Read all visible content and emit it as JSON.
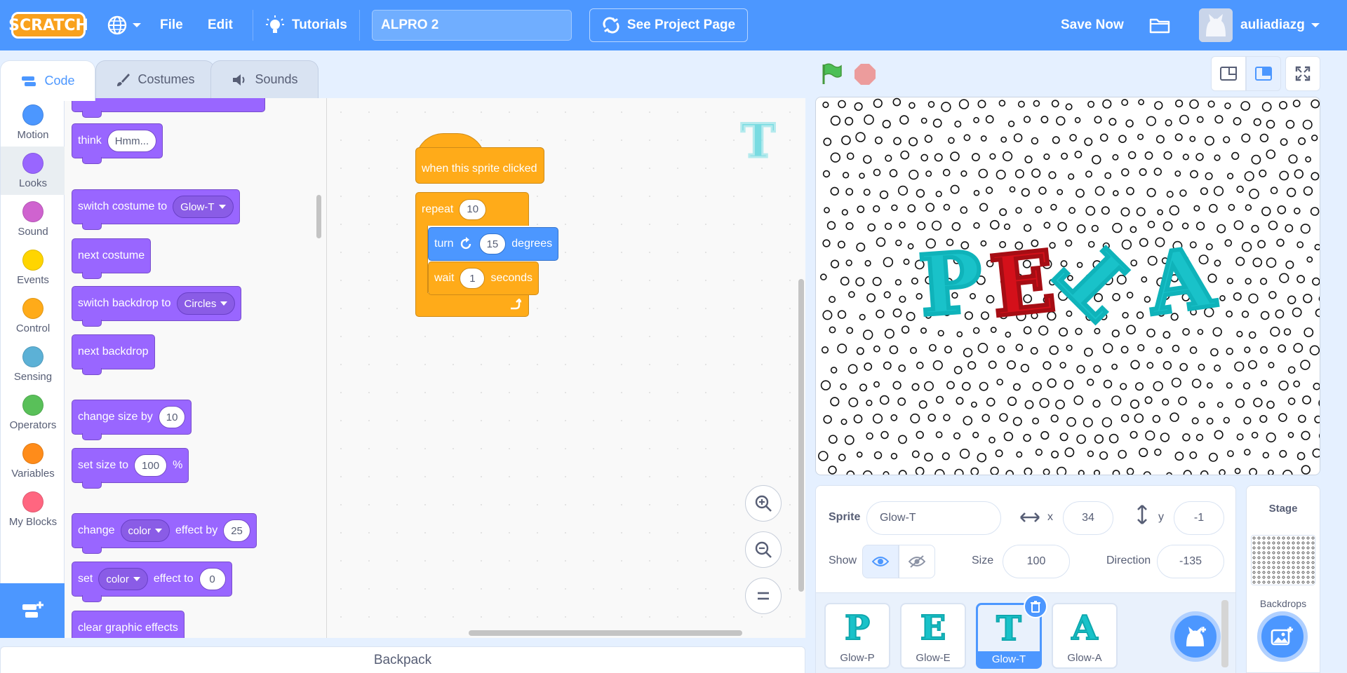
{
  "menubar": {
    "logo": "SCRATCH",
    "language_icon": "globe-icon",
    "file": "File",
    "edit": "Edit",
    "tutorials": "Tutorials",
    "project_title": "ALPRO 2",
    "see_project": "See Project Page",
    "save_now": "Save Now",
    "username": "auliadiazg"
  },
  "tabs": {
    "code": "Code",
    "costumes": "Costumes",
    "sounds": "Sounds"
  },
  "categories": [
    {
      "label": "Motion",
      "color": "#4c97ff"
    },
    {
      "label": "Looks",
      "color": "#9966ff"
    },
    {
      "label": "Sound",
      "color": "#cf63cf"
    },
    {
      "label": "Events",
      "color": "#ffd500"
    },
    {
      "label": "Control",
      "color": "#ffab19"
    },
    {
      "label": "Sensing",
      "color": "#5cb1d6"
    },
    {
      "label": "Operators",
      "color": "#59c059"
    },
    {
      "label": "Variables",
      "color": "#ff8c1a"
    },
    {
      "label": "My Blocks",
      "color": "#ff6680"
    }
  ],
  "palette": {
    "think": {
      "label": "think",
      "value": "Hmm..."
    },
    "switch_costume": {
      "label": "switch costume to",
      "value": "Glow-T"
    },
    "next_costume": "next costume",
    "switch_backdrop": {
      "label": "switch backdrop to",
      "value": "Circles"
    },
    "next_backdrop": "next backdrop",
    "change_size": {
      "label": "change size by",
      "value": "10"
    },
    "set_size": {
      "label": "set size to",
      "value": "100",
      "unit": "%"
    },
    "change_effect": {
      "label": "change",
      "effect": "color",
      "label2": "effect by",
      "value": "25"
    },
    "set_effect": {
      "label": "set",
      "effect": "color",
      "label2": "effect to",
      "value": "0"
    },
    "clear_effects": "clear graphic effects"
  },
  "script": {
    "hat": "when this sprite clicked",
    "repeat_label": "repeat",
    "repeat_value": "10",
    "turn_label": "turn",
    "turn_value": "15",
    "turn_unit": "degrees",
    "wait_label": "wait",
    "wait_value": "1",
    "wait_unit": "seconds"
  },
  "backpack": "Backpack",
  "stage": {
    "letters": [
      {
        "char": "P",
        "color": "#19c2c9"
      },
      {
        "char": "E",
        "color": "#d4101a"
      },
      {
        "char": "T",
        "color": "#19c2c9"
      },
      {
        "char": "A",
        "color": "#19c2c9"
      }
    ],
    "backdrop": "Circles"
  },
  "sprite_info": {
    "sprite_label": "Sprite",
    "sprite_name": "Glow-T",
    "x_label": "x",
    "x_value": "34",
    "y_label": "y",
    "y_value": "-1",
    "show_label": "Show",
    "size_label": "Size",
    "size_value": "100",
    "direction_label": "Direction",
    "direction_value": "-135"
  },
  "sprites": [
    {
      "name": "Glow-P",
      "glyph": "P",
      "selected": false
    },
    {
      "name": "Glow-E",
      "glyph": "E",
      "selected": false
    },
    {
      "name": "Glow-T",
      "glyph": "T",
      "selected": true
    },
    {
      "name": "Glow-A",
      "glyph": "A",
      "selected": false
    }
  ],
  "stage_pane": {
    "title": "Stage",
    "backdrops_label": "Backdrops"
  }
}
